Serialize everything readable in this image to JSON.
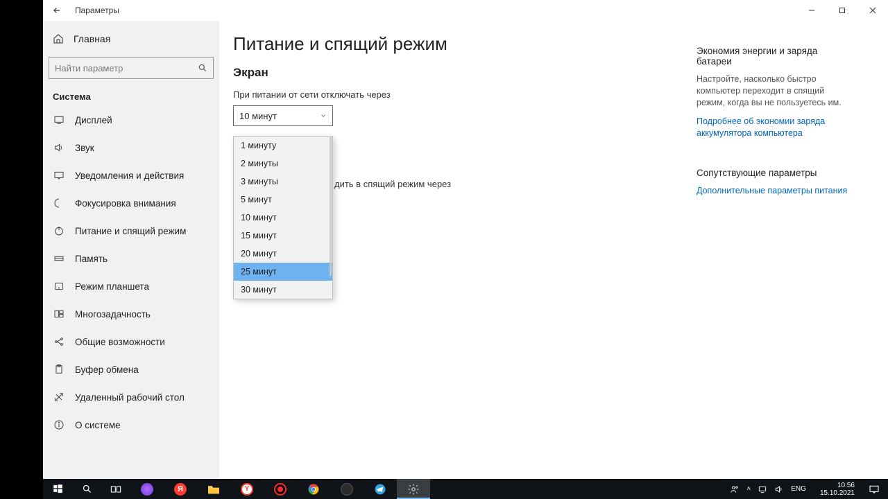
{
  "window": {
    "title": "Параметры",
    "min": "—",
    "max": "▢",
    "close": "✕"
  },
  "sidebar": {
    "home": "Главная",
    "search_placeholder": "Найти параметр",
    "category": "Система",
    "items": [
      {
        "icon": "display",
        "label": "Дисплей"
      },
      {
        "icon": "sound",
        "label": "Звук"
      },
      {
        "icon": "notify",
        "label": "Уведомления и действия"
      },
      {
        "icon": "focus",
        "label": "Фокусировка внимания"
      },
      {
        "icon": "power",
        "label": "Питание и спящий режим"
      },
      {
        "icon": "storage",
        "label": "Память"
      },
      {
        "icon": "tablet",
        "label": "Режим планшета"
      },
      {
        "icon": "multitask",
        "label": "Многозадачность"
      },
      {
        "icon": "shared",
        "label": "Общие возможности"
      },
      {
        "icon": "clipboard",
        "label": "Буфер обмена"
      },
      {
        "icon": "remote",
        "label": "Удаленный рабочий стол"
      },
      {
        "icon": "about",
        "label": "О системе"
      }
    ]
  },
  "main": {
    "title": "Питание и спящий режим",
    "screen_section": "Экран",
    "screen_label": "При питании от сети отключать через",
    "screen_value": "10 минут",
    "sleep_label_partial": "дить в спящий режим через",
    "dropdown": {
      "options": [
        "1 минуту",
        "2 минуты",
        "3 минуты",
        "5 минут",
        "10 минут",
        "15 минут",
        "20 минут",
        "25 минут",
        "30 минут"
      ],
      "highlighted": "25 минут"
    }
  },
  "right": {
    "h1": "Экономия энергии и заряда батареи",
    "p1": "Настройте, насколько быстро компьютер переходит в спящий режим, когда вы не пользуетесь им.",
    "link1": "Подробнее об экономии заряда аккумулятора компьютера",
    "h2": "Сопутствующие параметры",
    "link2": "Дополнительные параметры питания"
  },
  "taskbar": {
    "lang": "ENG",
    "time": "10:56",
    "date": "15.10.2021"
  }
}
